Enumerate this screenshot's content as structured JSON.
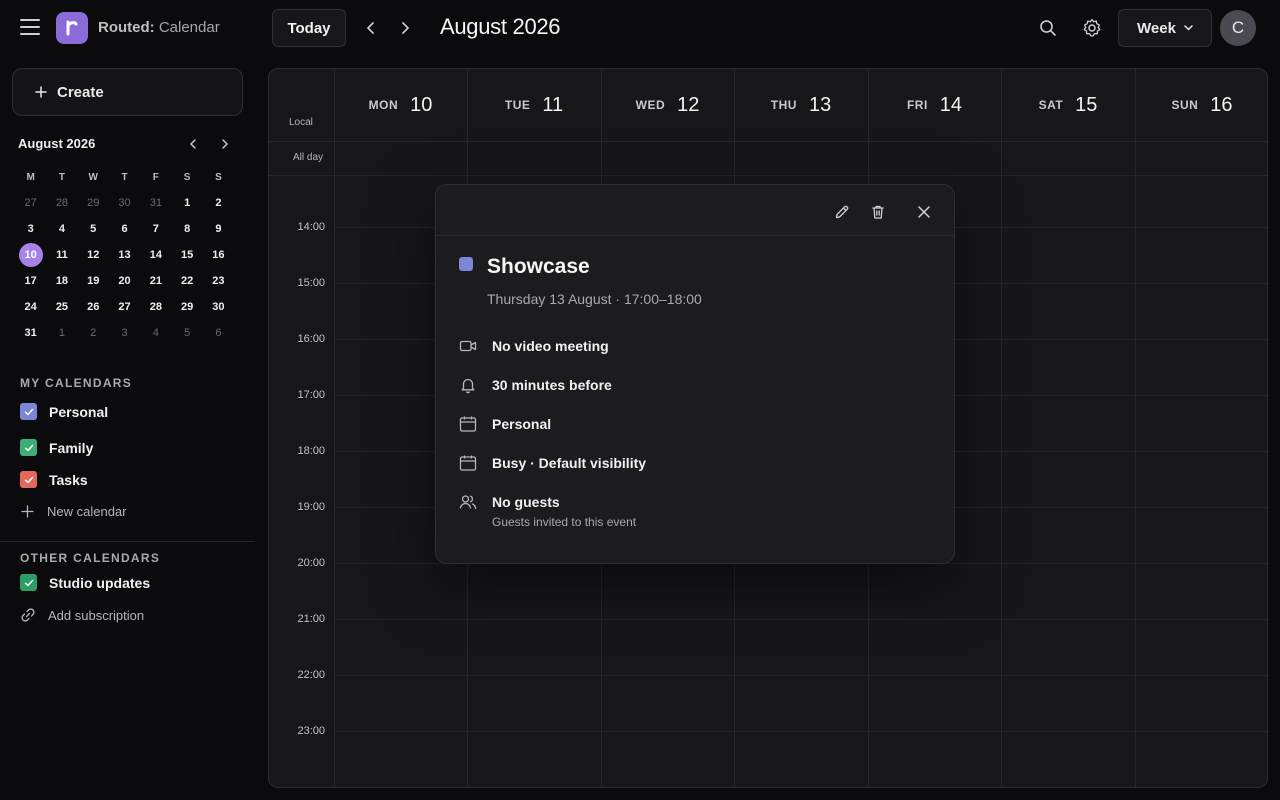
{
  "app": {
    "brand": "Routed:",
    "section": "Calendar"
  },
  "toolbar": {
    "today_label": "Today",
    "month_title": "August 2026",
    "view_label": "Week",
    "avatar_initial": "C"
  },
  "sidebar": {
    "create_label": "Create",
    "mini_calendar": {
      "title": "August 2026",
      "weekdays": [
        "M",
        "T",
        "W",
        "T",
        "F",
        "S",
        "S"
      ],
      "weeks": [
        [
          "27",
          "28",
          "29",
          "30",
          "31",
          "1",
          "2"
        ],
        [
          "3",
          "4",
          "5",
          "6",
          "7",
          "8",
          "9"
        ],
        [
          "10",
          "11",
          "12",
          "13",
          "14",
          "15",
          "16"
        ],
        [
          "17",
          "18",
          "19",
          "20",
          "21",
          "22",
          "23"
        ],
        [
          "24",
          "25",
          "26",
          "27",
          "28",
          "29",
          "30"
        ],
        [
          "31",
          "1",
          "2",
          "3",
          "4",
          "5",
          "6"
        ]
      ],
      "today": "10"
    },
    "my_calendars_title": "MY CALENDARS",
    "my_calendars": [
      {
        "label": "Personal",
        "color": "#7b86d6"
      },
      {
        "label": "Family",
        "color": "#3fae74"
      },
      {
        "label": "Tasks",
        "color": "#e0695c"
      }
    ],
    "new_calendar_label": "New calendar",
    "other_calendars_title": "OTHER CALENDARS",
    "other_calendars": [
      {
        "label": "Studio updates",
        "color": "#2f9e66"
      }
    ],
    "add_subscription_label": "Add subscription"
  },
  "grid": {
    "timezone_label": "Local",
    "allday_label": "All day",
    "days": [
      {
        "name": "MON",
        "date": "10"
      },
      {
        "name": "TUE",
        "date": "11"
      },
      {
        "name": "WED",
        "date": "12"
      },
      {
        "name": "THU",
        "date": "13"
      },
      {
        "name": "FRI",
        "date": "14"
      },
      {
        "name": "SAT",
        "date": "15"
      },
      {
        "name": "SUN",
        "date": "16"
      }
    ],
    "hours": [
      "14:00",
      "15:00",
      "16:00",
      "17:00",
      "18:00",
      "19:00",
      "20:00",
      "21:00",
      "22:00",
      "23:00"
    ]
  },
  "event": {
    "title": "Showcase",
    "color": "#7b86d6",
    "time": "Thursday 13 August · 17:00–18:00",
    "video": "No video meeting",
    "reminder": "30 minutes before",
    "calendar": "Personal",
    "availability": "Busy · Default visibility",
    "guests": "No guests",
    "guests_sub": "Guests invited to this event"
  }
}
